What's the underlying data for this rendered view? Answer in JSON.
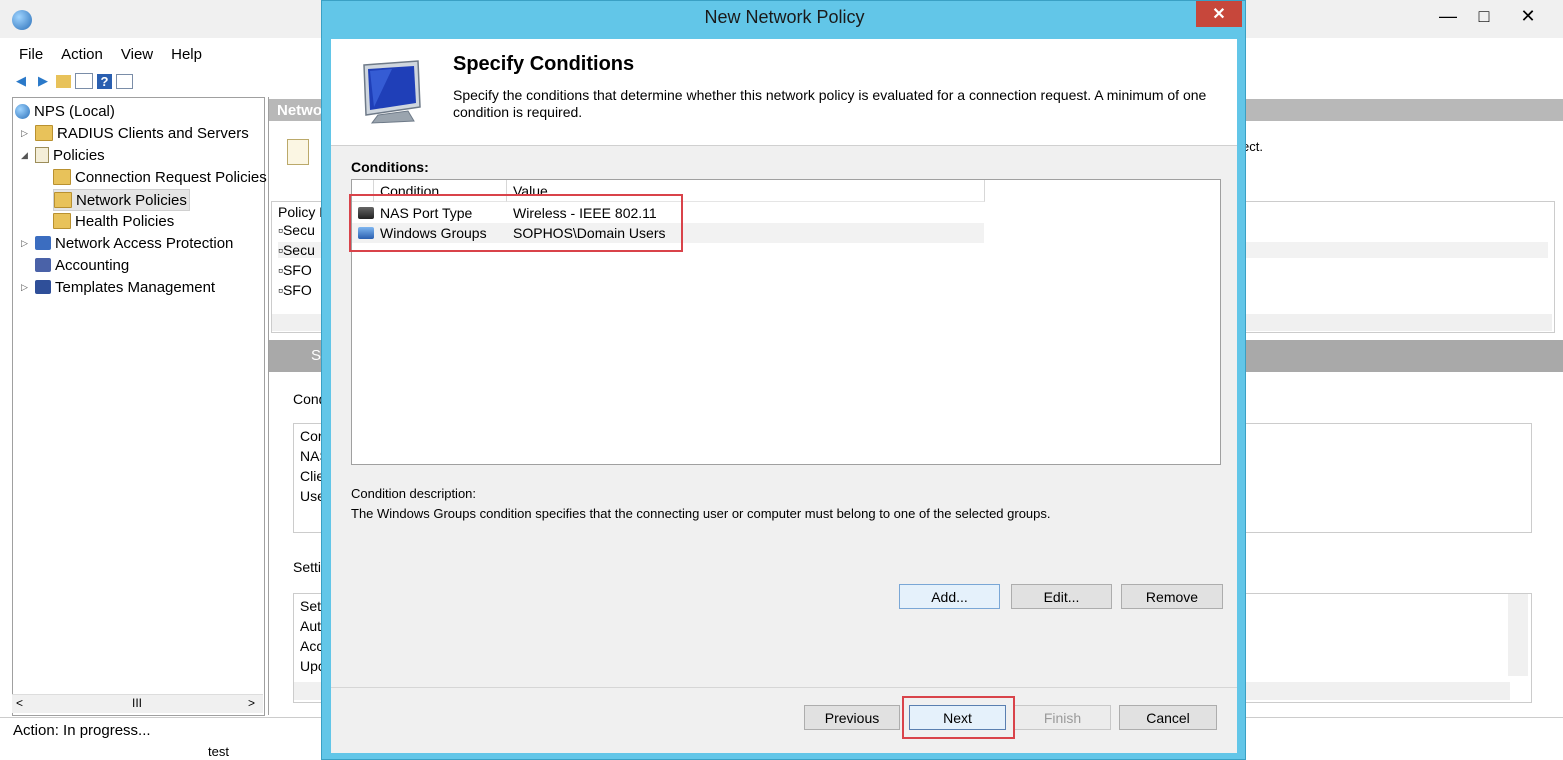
{
  "background_window": {
    "menu": [
      "File",
      "Action",
      "View",
      "Help"
    ],
    "tree": [
      {
        "label": "NPS (Local)",
        "icon": "nps-globe-icon"
      },
      {
        "label": "RADIUS Clients and Servers",
        "icon": "folder-icon"
      },
      {
        "label": "Policies",
        "icon": "policies-icon"
      },
      {
        "label": "Connection Request Policies",
        "icon": "folder-icon"
      },
      {
        "label": "Network Policies",
        "icon": "network-policies-icon"
      },
      {
        "label": "Health Policies",
        "icon": "folder-icon"
      },
      {
        "label": "Network Access Protection",
        "icon": "nap-icon"
      },
      {
        "label": "Accounting",
        "icon": "accounting-icon"
      },
      {
        "label": "Templates Management",
        "icon": "templates-icon"
      }
    ],
    "right_pane": {
      "header": "Netwo",
      "intro_tail": "ect.",
      "policy_column": "Policy N",
      "policy_rows": [
        "Secu",
        "Secu",
        "SFO",
        "SFO"
      ],
      "detail_title": "S",
      "conditions_label": "Condi",
      "conditions_items": [
        "Cor",
        "NAS",
        "Clie",
        "Use"
      ],
      "settings_label": "Settin",
      "settings_items": [
        "Set",
        "Auth",
        "Acc",
        "Upc"
      ]
    },
    "status": "Action:  In progress...",
    "bottom_peek": "test",
    "scroll_thumb": "III"
  },
  "dialog": {
    "title": "New Network Policy",
    "close": "✕",
    "heading": "Specify Conditions",
    "subtitle": "Specify the conditions that determine whether this network policy is evaluated for a connection request. A minimum of one condition is required.",
    "conditions_label": "Conditions:",
    "columns": [
      "Condition",
      "Value"
    ],
    "conditions": [
      {
        "name": "NAS Port Type",
        "value": "Wireless - IEEE 802.11",
        "icon": "nas-port-icon"
      },
      {
        "name": "Windows Groups",
        "value": "SOPHOS\\Domain Users",
        "icon": "windows-groups-icon"
      }
    ],
    "description_label": "Condition description:",
    "description": "The Windows Groups condition specifies that the connecting user or computer must belong to one of the selected groups.",
    "buttons": {
      "add": "Add...",
      "edit": "Edit...",
      "remove": "Remove"
    },
    "footer": {
      "previous": "Previous",
      "next": "Next",
      "finish": "Finish",
      "cancel": "Cancel"
    }
  },
  "colors": {
    "dialog_frame": "#62c6e8",
    "highlight": "#d9434a",
    "close_button": "#c7473b"
  }
}
